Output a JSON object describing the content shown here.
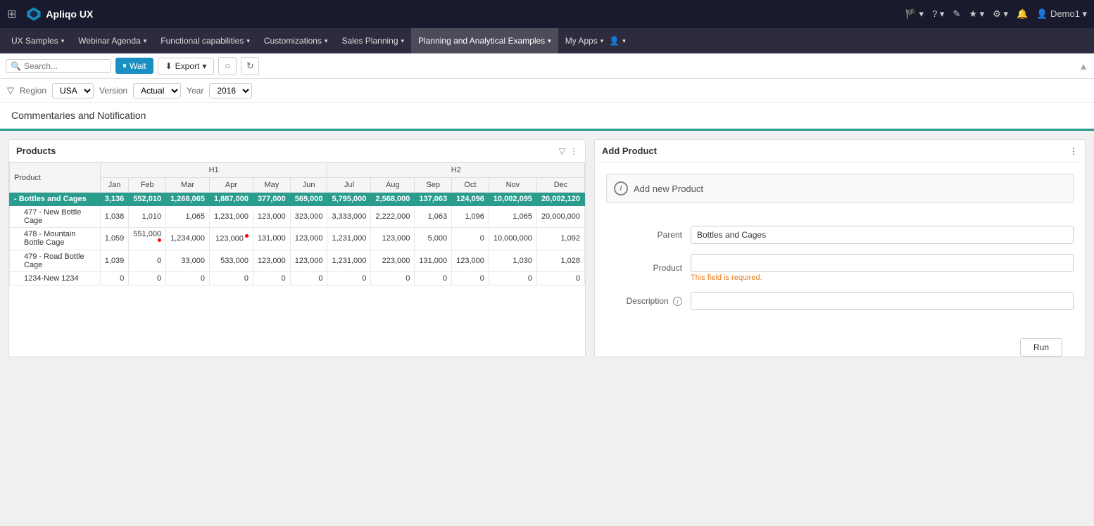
{
  "app": {
    "grid_icon": "⊞",
    "logo_text": "Apliqo UX",
    "nav_right": {
      "flag_icon": "🏴",
      "user_icon": "👤",
      "edit_icon": "✎",
      "star_icon": "★",
      "gear_icon": "⚙",
      "bell_icon": "🔔",
      "user_label": "Demo1"
    }
  },
  "menu": {
    "items": [
      {
        "label": "UX Samples",
        "active": false
      },
      {
        "label": "Webinar Agenda",
        "active": false
      },
      {
        "label": "Functional capabilities",
        "active": false
      },
      {
        "label": "Customizations",
        "active": false
      },
      {
        "label": "Sales Planning",
        "active": false
      },
      {
        "label": "Planning and Analytical Examples",
        "active": true
      },
      {
        "label": "My Apps",
        "active": false
      }
    ]
  },
  "toolbar": {
    "search_placeholder": "Search...",
    "wait_label": "Wait",
    "export_label": "Export",
    "wait_icon": "⏸",
    "export_icon": "⬇",
    "reset_icon": "○",
    "refresh_icon": "↻",
    "right_icon": "▲"
  },
  "filters": {
    "filter_icon": "▽",
    "region_label": "Region",
    "region_value": "USA",
    "version_label": "Version",
    "version_value": "Actual",
    "year_label": "Year",
    "year_value": "2016"
  },
  "page": {
    "title": "Commentaries and Notification"
  },
  "products_panel": {
    "title": "Products",
    "filter_icon": "▽",
    "menu_icon": "⋮",
    "h1_label": "H1",
    "h2_label": "H2",
    "columns": [
      "Product",
      "Jan",
      "Feb",
      "Mar",
      "Apr",
      "May",
      "Jun",
      "Jul",
      "Aug",
      "Sep",
      "Oct",
      "Nov",
      "Dec"
    ],
    "rows": [
      {
        "type": "group",
        "product": "- Bottles and Cages",
        "jan": "3,136",
        "feb": "552,010",
        "mar": "1,268,065",
        "apr": "1,887,000",
        "may": "377,000",
        "jun": "569,000",
        "jul": "5,795,000",
        "aug": "2,568,000",
        "sep": "137,063",
        "oct": "124,096",
        "nov": "10,002,095",
        "dec": "20,002,120"
      },
      {
        "type": "data",
        "product": "477 - New Bottle Cage",
        "jan": "1,038",
        "feb": "1,010",
        "mar": "1,065",
        "apr": "1,231,000",
        "may": "123,000",
        "jun": "323,000",
        "jul": "3,333,000",
        "aug": "2,222,000",
        "sep": "1,063",
        "oct": "1,096",
        "nov": "1,065",
        "dec": "20,000,000"
      },
      {
        "type": "data",
        "product": "478 - Mountain Bottle Cage",
        "jan": "1,059",
        "feb": "551,000",
        "mar": "1,234,000",
        "apr": "123,000",
        "may": "131,000",
        "jun": "123,000",
        "jul": "1,231,000",
        "aug": "123,000",
        "sep": "5,000",
        "oct": "0",
        "nov": "10,000,000",
        "dec": "1,092",
        "has_comment_feb": true,
        "has_comment_mar": false,
        "has_comment_apr": true
      },
      {
        "type": "data",
        "product": "479 - Road Bottle Cage",
        "jan": "1,039",
        "feb": "0",
        "mar": "33,000",
        "apr": "533,000",
        "may": "123,000",
        "jun": "123,000",
        "jul": "1,231,000",
        "aug": "223,000",
        "sep": "131,000",
        "oct": "123,000",
        "nov": "1,030",
        "dec": "1,028"
      },
      {
        "type": "data",
        "product": "1234-New 1234",
        "jan": "0",
        "feb": "0",
        "mar": "0",
        "apr": "0",
        "may": "0",
        "jun": "0",
        "jul": "0",
        "aug": "0",
        "sep": "0",
        "oct": "0",
        "nov": "0",
        "dec": "0"
      }
    ]
  },
  "add_product_panel": {
    "title": "Add Product",
    "menu_icon": "⋮",
    "add_new_label": "Add new Product",
    "parent_label": "Parent",
    "parent_value": "Bottles and Cages",
    "product_label": "Product",
    "product_placeholder": "",
    "required_msg": "This field is required.",
    "description_label": "Description",
    "description_placeholder": "",
    "run_label": "Run"
  }
}
